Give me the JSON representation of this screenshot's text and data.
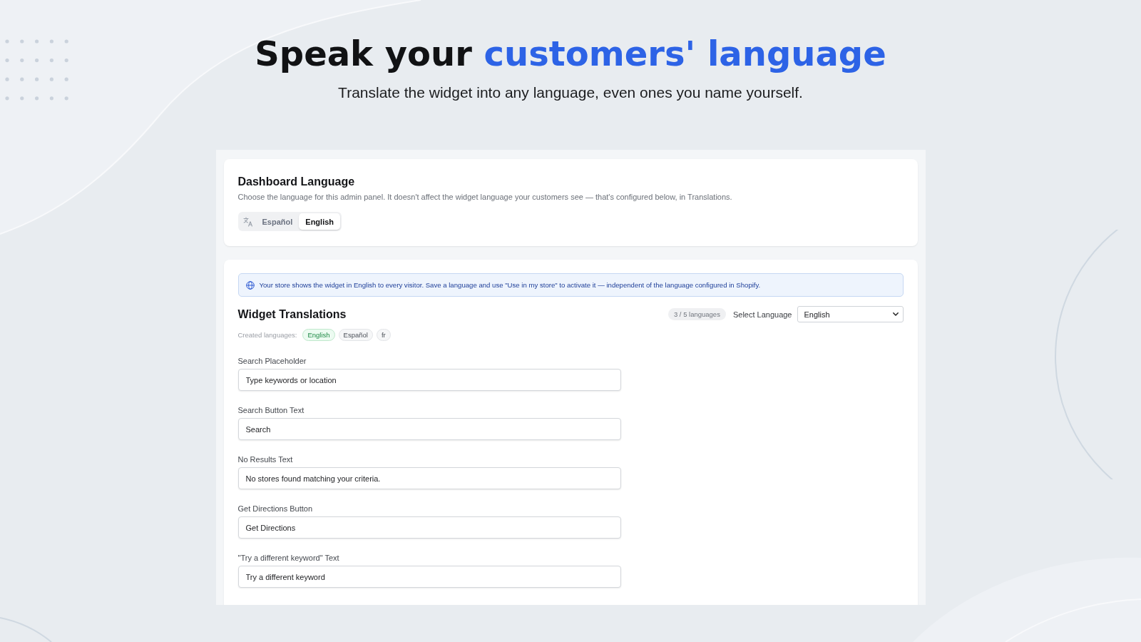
{
  "hero": {
    "title_parts": [
      {
        "text": "Speak your",
        "highlight": false
      },
      {
        "text": "customers' language",
        "highlight": true
      }
    ],
    "subtitle": "Translate the widget into any language, even ones you name yourself."
  },
  "dashboard_language": {
    "title": "Dashboard Language",
    "description": "Choose the language for this admin panel. It doesn't affect the widget language your customers see — that's configured below, in Translations.",
    "options": [
      {
        "label": "Español",
        "selected": false
      },
      {
        "label": "English",
        "selected": true
      }
    ]
  },
  "widget_translations": {
    "notice": "Your store shows the widget in English to every visitor. Save a language and use \"Use in my store\" to activate it — independent of the language configured in Shopify.",
    "title": "Widget Translations",
    "language_count": "3 / 5 languages",
    "select": {
      "label": "Select Language",
      "value": "English"
    },
    "created_languages": {
      "label": "Created languages:",
      "items": [
        {
          "label": "English",
          "selected": true
        },
        {
          "label": "Español",
          "selected": false
        },
        {
          "label": "fr",
          "selected": false
        }
      ]
    },
    "fields": [
      {
        "label": "Search Placeholder",
        "value": "Type keywords or location"
      },
      {
        "label": "Search Button Text",
        "value": "Search"
      },
      {
        "label": "No Results Text",
        "value": "No stores found matching your criteria."
      },
      {
        "label": "Get Directions Button",
        "value": "Get Directions"
      },
      {
        "label": "\"Try a different keyword\" Text",
        "value": "Try a different keyword"
      }
    ]
  }
}
